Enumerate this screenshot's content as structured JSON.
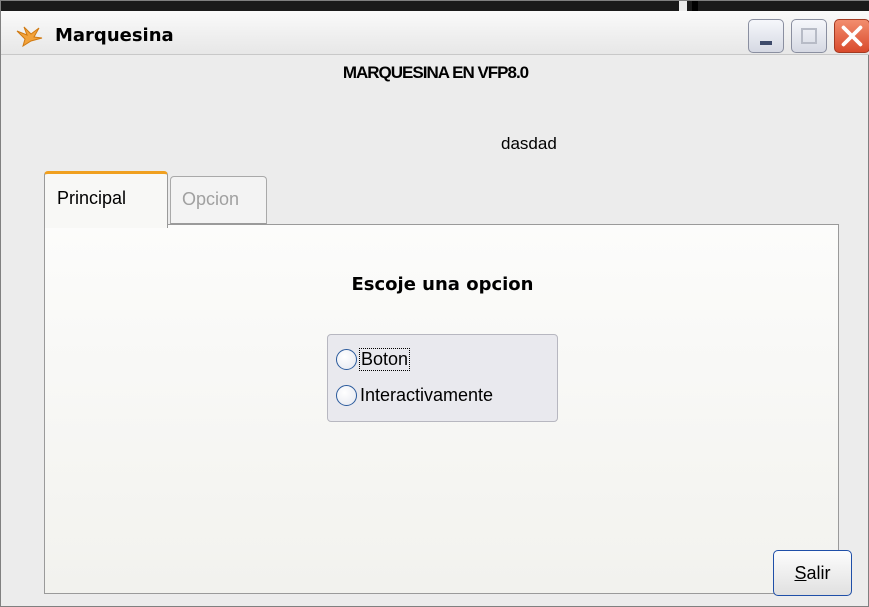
{
  "window": {
    "title": "Marquesina",
    "icon": "app-flame-icon",
    "controls": [
      "minimize-icon",
      "maximize-icon",
      "close-icon"
    ]
  },
  "header": {
    "heading": "MARQUESINA EN VFP8.0",
    "marquee_text": "dasdad"
  },
  "tabs": [
    {
      "label": "Principal",
      "active": true
    },
    {
      "label": "Opcion",
      "active": false
    }
  ],
  "principal": {
    "prompt": "Escoje una opcion",
    "options": [
      {
        "label": "Boton",
        "selected": false,
        "focused": true
      },
      {
        "label": "Interactivamente",
        "selected": false,
        "focused": false
      }
    ]
  },
  "actions": {
    "exit_accel": "S",
    "exit_rest": "alir"
  },
  "colors": {
    "active_tab_accent": "#f0a020",
    "close_button": "#d94a2c",
    "focus_border": "#1f4fa8"
  }
}
